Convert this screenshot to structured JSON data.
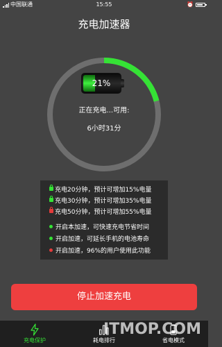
{
  "status_bar": {
    "carrier": "中国联通",
    "time": "15:55"
  },
  "title": "充电加速器",
  "colors": {
    "background": "#444444",
    "accent_green": "#35e235",
    "ring_track": "#6e6e6e",
    "stop_button": "#ee3f3f",
    "nav_active": "#35e235",
    "panel": "#2b2b2b"
  },
  "charge": {
    "percent_label": "21%",
    "progress_fraction": 0.21,
    "status_text": "正在充电...可用:",
    "remaining_time": "6小时31分"
  },
  "boost_info": [
    {
      "text": "充电20分钟，预计可增加15%电量",
      "icon": "lock-green-icon",
      "color": "#35e235"
    },
    {
      "text": "充电30分钟，预计可增加35%电量",
      "icon": "lock-green-icon",
      "color": "#35e235"
    },
    {
      "text": "充电50分钟，预计可增加55%电量",
      "icon": "lock-red-icon",
      "color": "#e33b3b"
    }
  ],
  "tips": [
    {
      "text": "开启本加速，可快速充电节省时间",
      "color": "#35e235"
    },
    {
      "text": "开启加速，可延长手机的电池寿命",
      "color": "#35e235"
    },
    {
      "text": "开启加速，96%的用户使用此功能",
      "color": "#e33b3b"
    }
  ],
  "stop_button_label": "停止加速充电",
  "nav": [
    {
      "label": "充电保护",
      "icon": "lightning-icon",
      "active": true
    },
    {
      "label": "耗电排行",
      "icon": "bar-chart-icon",
      "active": false
    },
    {
      "label": "省电模式",
      "icon": "battery-icon",
      "active": false
    }
  ],
  "watermark": "ITMOP.COM"
}
